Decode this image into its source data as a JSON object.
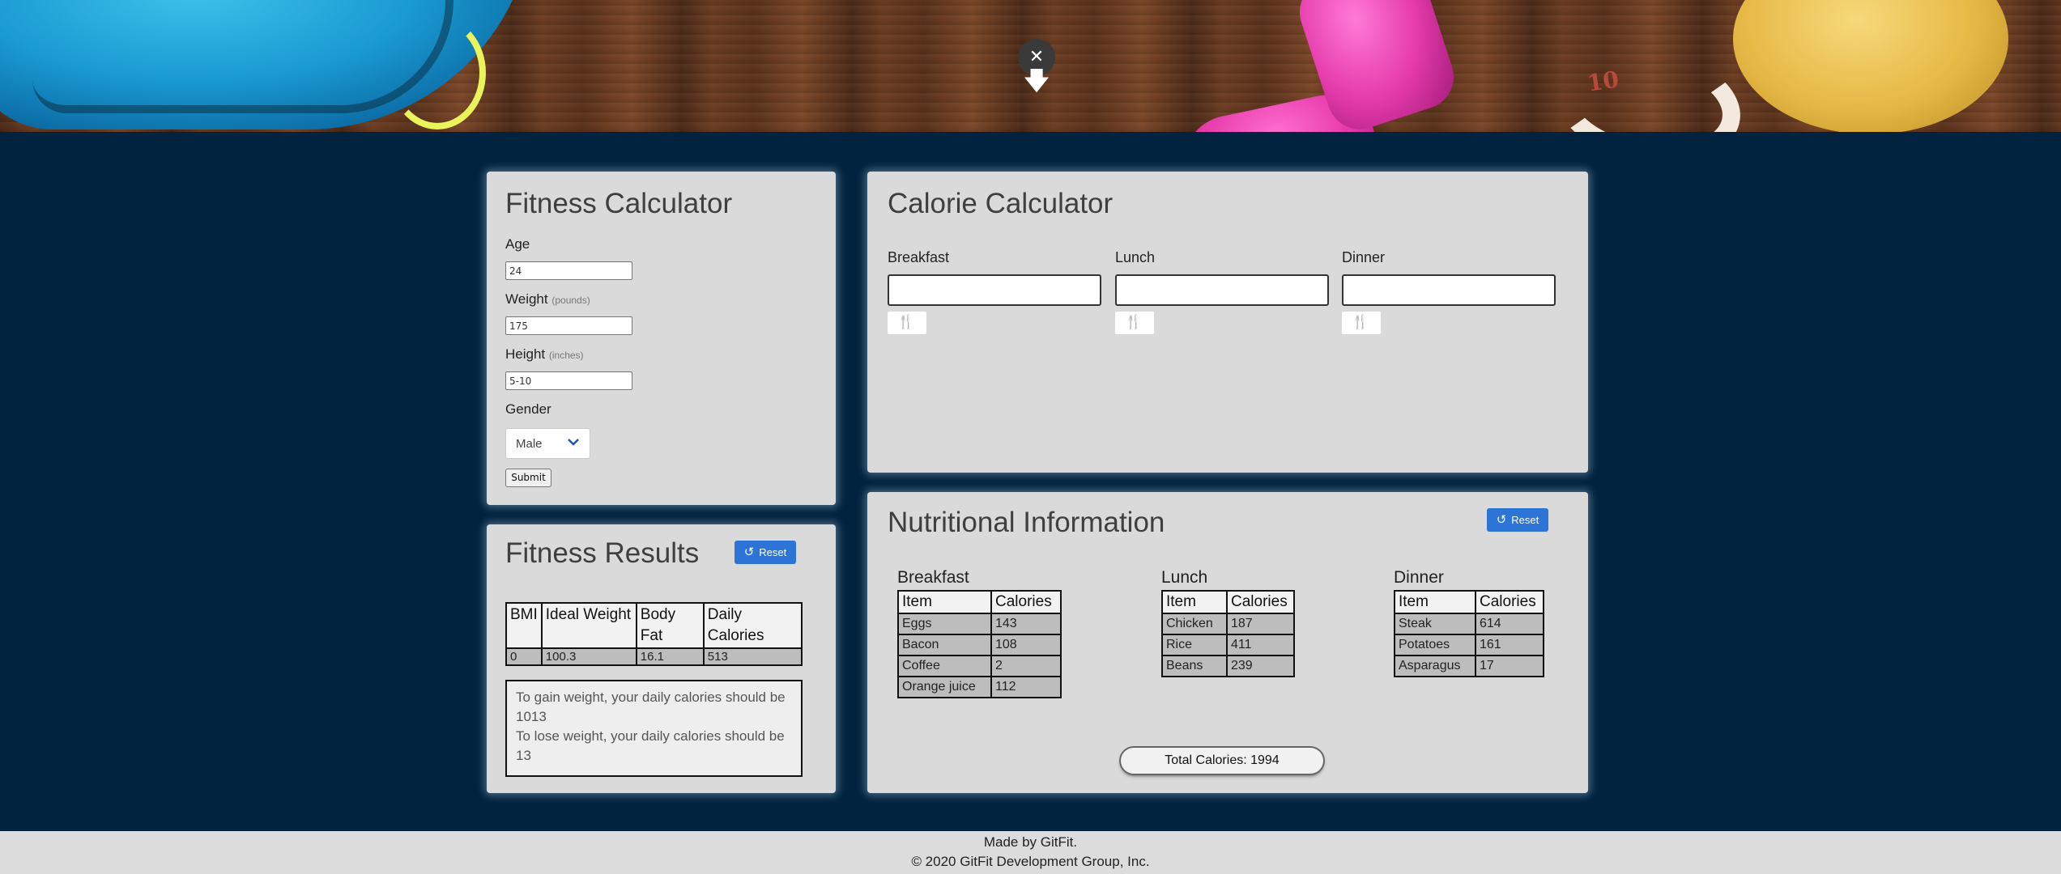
{
  "hero": {
    "tape_text": "10"
  },
  "overlay": {
    "close_glyph": "✕",
    "down_glyph": "🡇"
  },
  "fitness_calculator": {
    "title": "Fitness Calculator",
    "age_label": "Age",
    "age_value": "24",
    "weight_label": "Weight",
    "weight_unit": "(pounds)",
    "weight_value": "175",
    "height_label": "Height",
    "height_unit": "(inches)",
    "height_value": "5-10",
    "gender_label": "Gender",
    "gender_value": "Male",
    "submit_label": "Submit"
  },
  "fitness_results": {
    "title": "Fitness Results",
    "reset_label": "Reset",
    "columns": [
      "BMI",
      "Ideal Weight",
      "Body Fat",
      "Daily Calories"
    ],
    "row": [
      "0",
      "100.3",
      "16.1",
      "513"
    ],
    "gain_text": "To gain weight, your daily calories should be 1013",
    "lose_text": "To lose weight, your daily calories should be 13"
  },
  "calorie_calculator": {
    "title": "Calorie Calculator",
    "meals": [
      {
        "label": "Breakfast",
        "value": ""
      },
      {
        "label": "Lunch",
        "value": ""
      },
      {
        "label": "Dinner",
        "value": ""
      }
    ],
    "add_icon": "🍴"
  },
  "nutritional_info": {
    "title": "Nutritional Information",
    "reset_label": "Reset",
    "col_item": "Item",
    "col_calories": "Calories",
    "breakfast": {
      "title": "Breakfast",
      "rows": [
        {
          "item": "Eggs",
          "calories": "143"
        },
        {
          "item": "Bacon",
          "calories": "108"
        },
        {
          "item": "Coffee",
          "calories": "2"
        },
        {
          "item": "Orange juice",
          "calories": "112"
        }
      ]
    },
    "lunch": {
      "title": "Lunch",
      "rows": [
        {
          "item": "Chicken",
          "calories": "187"
        },
        {
          "item": "Rice",
          "calories": "411"
        },
        {
          "item": "Beans",
          "calories": "239"
        }
      ]
    },
    "dinner": {
      "title": "Dinner",
      "rows": [
        {
          "item": "Steak",
          "calories": "614"
        },
        {
          "item": "Potatoes",
          "calories": "161"
        },
        {
          "item": "Asparagus",
          "calories": "17"
        }
      ]
    },
    "total_label": "Total Calories: 1994"
  },
  "footer": {
    "made_by": "Made by GitFit.",
    "copyright": "© 2020 GitFit Development Group, Inc."
  }
}
